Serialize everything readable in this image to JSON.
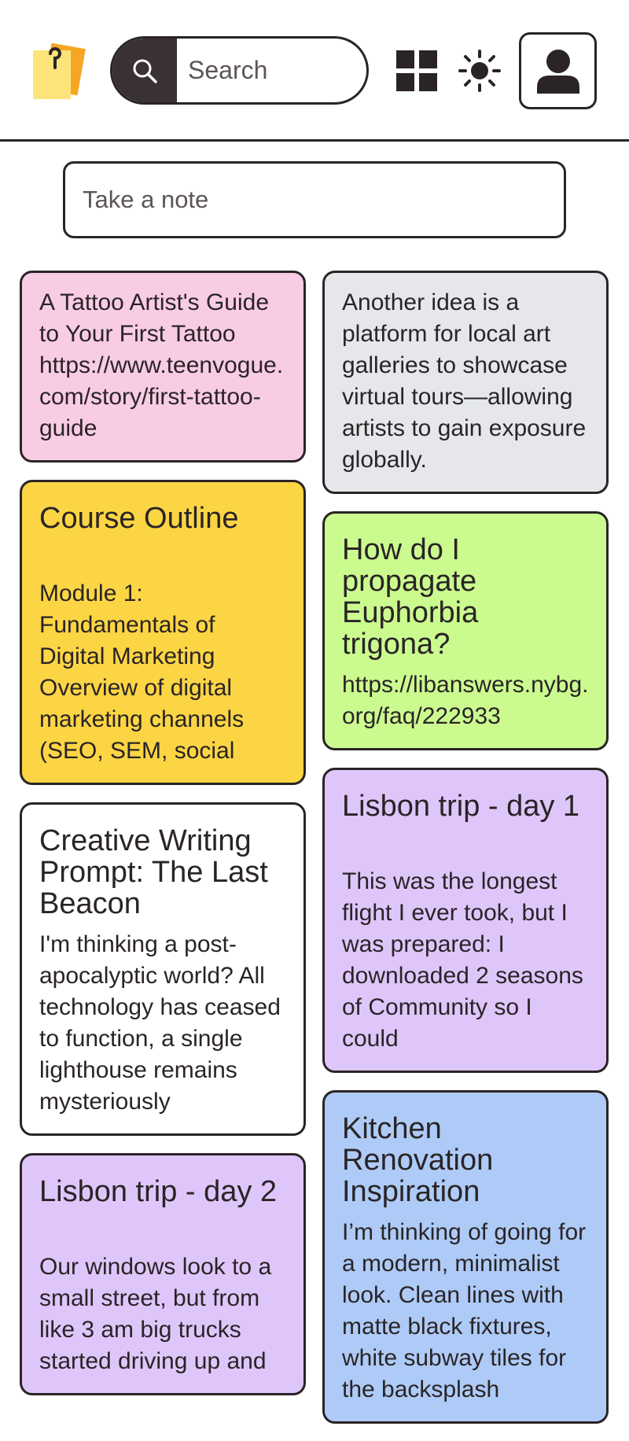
{
  "header": {
    "search_placeholder": "Search",
    "logo_icon": "sticky-notes-logo-icon",
    "search_icon": "search-icon",
    "grid_icon": "grid-view-icon",
    "theme_icon": "sun-icon",
    "avatar_icon": "user-avatar-icon"
  },
  "composer": {
    "placeholder": "Take a note"
  },
  "colors": {
    "pink": "#f9cce6",
    "gray": "#e5e7eb",
    "yellow": "#fcd544",
    "green": "#cbfb8f",
    "white": "#ffffff",
    "purple": "#dfc6fa",
    "blue": "#aecbf7",
    "border": "#2a2426"
  },
  "notes_left": [
    {
      "title": "",
      "body": "A Tattoo Artist's Guide to Your First Tattoo https://www.teenvogue.com/story/first-tattoo-guide",
      "color": "#f9cce6"
    },
    {
      "title": "Course Outline",
      "body": "Module 1: Fundamentals of Digital Marketing Overview of digital marketing channels (SEO, SEM, social",
      "color": "#fcd544"
    },
    {
      "title": "Creative Writing Prompt: The Last Beacon",
      "body": "I'm thinking a post-apocalyptic world? All technology has ceased to function, a single lighthouse remains mysteriously",
      "color": "#ffffff"
    },
    {
      "title": "Lisbon trip - day 2",
      "body": "Our windows look to a small street, but from like 3 am big trucks started driving up and",
      "color": "#dfc6fa"
    }
  ],
  "notes_right": [
    {
      "title": "",
      "body": "Another idea is a platform for local art galleries to showcase virtual tours—allowing artists to gain exposure globally.",
      "color": "#e5e7eb"
    },
    {
      "title": "How do I propagate Euphorbia trigona?",
      "body": "https://libanswers.nybg.org/faq/222933",
      "color": "#cbfb8f"
    },
    {
      "title": "Lisbon trip - day 1",
      "body": "This was the longest flight I ever took, but I was prepared: I downloaded 2 seasons of Community so I could",
      "color": "#dfc6fa"
    },
    {
      "title": "Kitchen Renovation Inspiration",
      "body": "I’m thinking of going for a modern, minimalist look. Clean lines with matte black fixtures, white subway tiles for the backsplash",
      "color": "#aecbf7"
    }
  ]
}
